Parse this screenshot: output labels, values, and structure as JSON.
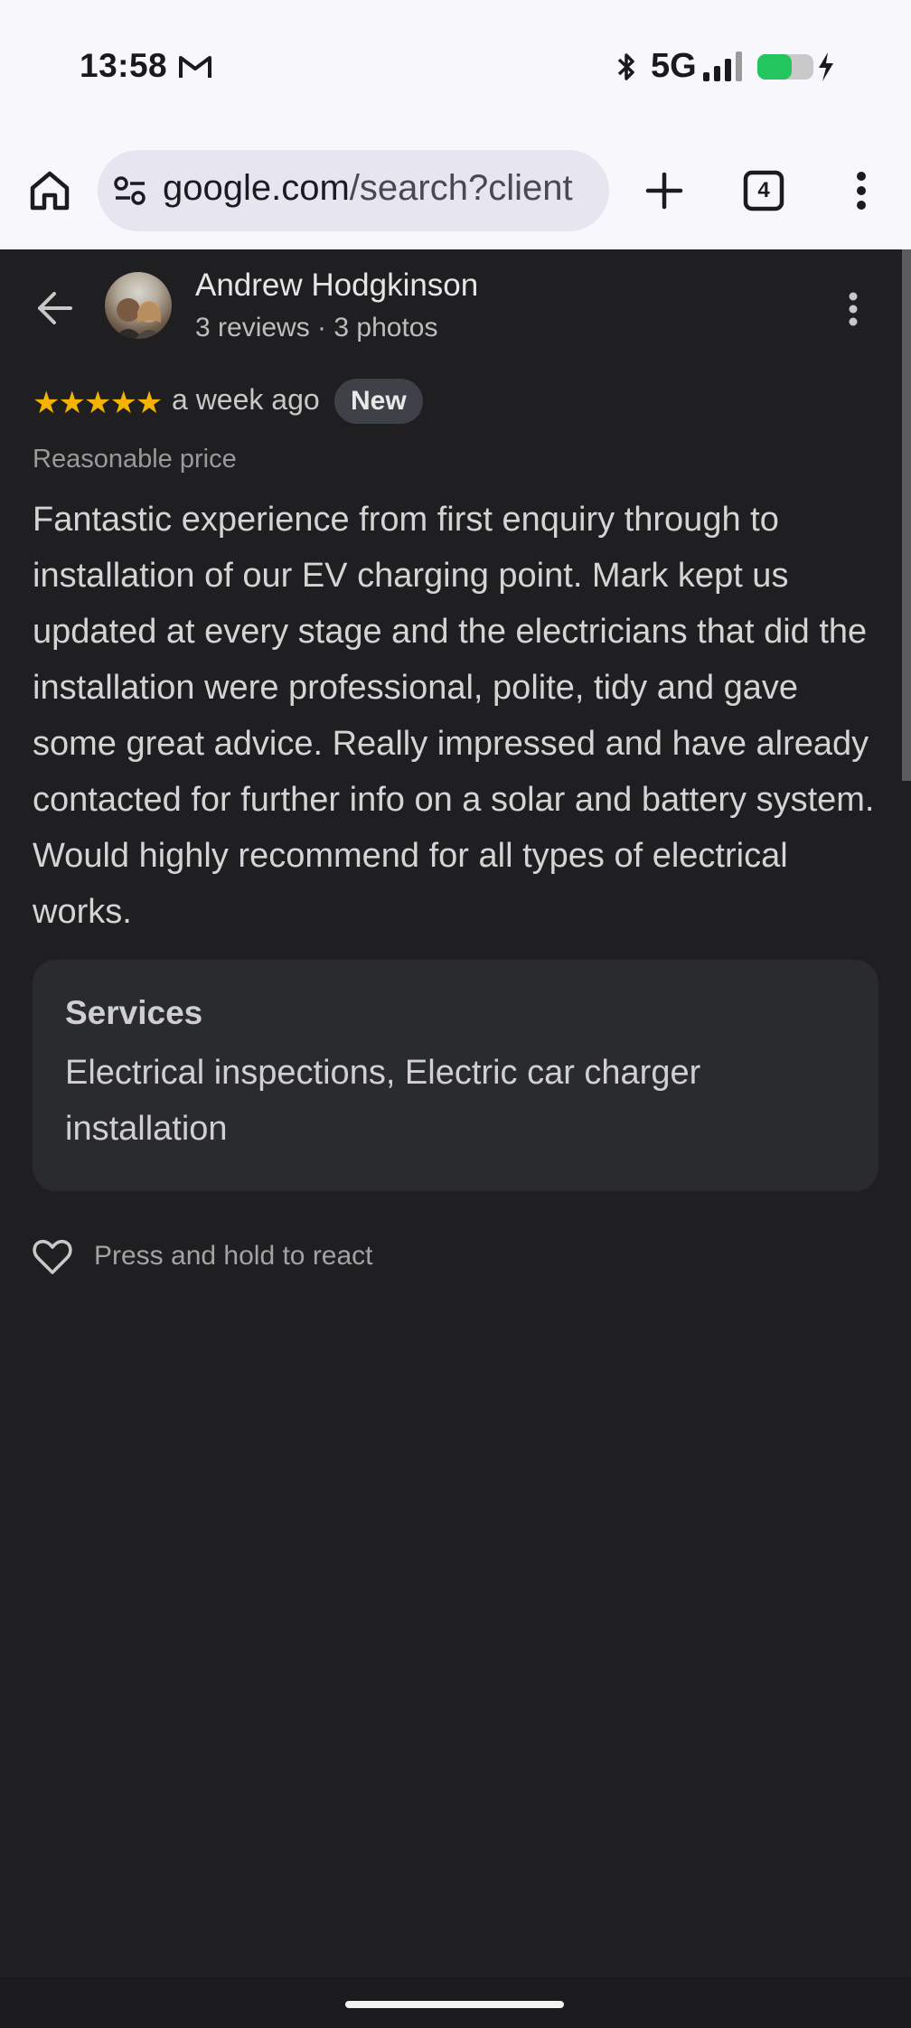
{
  "status_bar": {
    "time": "13:58",
    "network": "5G",
    "icons": [
      "gmail-icon",
      "bluetooth-icon",
      "signal-icon",
      "battery-charging-icon"
    ]
  },
  "browser": {
    "url_domain": "google.com",
    "url_path": "/search?client",
    "tab_count": "4",
    "icons": [
      "home-icon",
      "tune-icon",
      "plus-icon",
      "tabs-icon",
      "more-vert-icon"
    ]
  },
  "review": {
    "reviewer_name": "Andrew Hodgkinson",
    "reviewer_meta": "3 reviews · 3 photos",
    "stars": "★★★★★",
    "rating": 5,
    "time_ago": "a week ago",
    "badge": "New",
    "price_label": "Reasonable price",
    "text": "Fantastic experience from first enquiry through to installation of our EV charging point. Mark kept us updated at every stage and the electricians that did the installation were professional, polite, tidy and gave some great advice. Really impressed and have already contacted for further info on a solar and battery system. Would highly recommend for all types of electrical works.",
    "services_title": "Services",
    "services_value": "Electrical inspections, Electric car charger installation",
    "react_hint": "Press and hold to react"
  },
  "colors": {
    "background": "#1f1f21",
    "star": "#f5b301",
    "card": "#2a2b2e",
    "toolbar": "#f8f7fc"
  }
}
